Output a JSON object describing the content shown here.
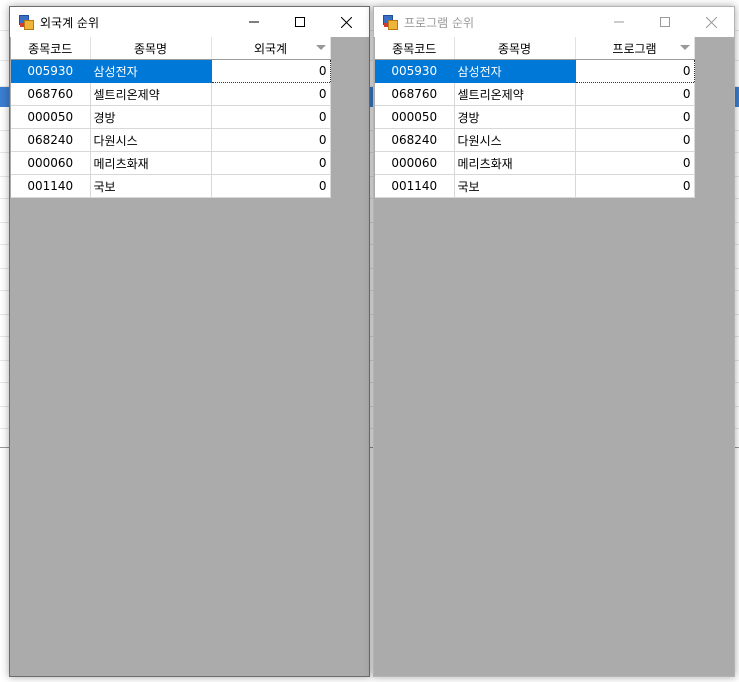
{
  "windows": [
    {
      "title": "외국계 순위",
      "active": true,
      "columns": [
        "종목코드",
        "종목명",
        "외국계"
      ],
      "rows": [
        {
          "code": "005930",
          "name": "삼성전자",
          "value": "0"
        },
        {
          "code": "068760",
          "name": "셀트리온제약",
          "value": "0"
        },
        {
          "code": "000050",
          "name": "경방",
          "value": "0"
        },
        {
          "code": "068240",
          "name": "다원시스",
          "value": "0"
        },
        {
          "code": "000060",
          "name": "메리츠화재",
          "value": "0"
        },
        {
          "code": "001140",
          "name": "국보",
          "value": "0"
        }
      ]
    },
    {
      "title": "프로그램 순위",
      "active": false,
      "columns": [
        "종목코드",
        "종목명",
        "프로그램"
      ],
      "rows": [
        {
          "code": "005930",
          "name": "삼성전자",
          "value": "0"
        },
        {
          "code": "068760",
          "name": "셀트리온제약",
          "value": "0"
        },
        {
          "code": "000050",
          "name": "경방",
          "value": "0"
        },
        {
          "code": "068240",
          "name": "다원시스",
          "value": "0"
        },
        {
          "code": "000060",
          "name": "메리츠화재",
          "value": "0"
        },
        {
          "code": "001140",
          "name": "국보",
          "value": "0"
        }
      ]
    }
  ],
  "selected_row_index": 0,
  "colors": {
    "selection": "#0078d7",
    "client_background": "#ababab"
  },
  "icons": [
    "app-icon",
    "minimize-icon",
    "maximize-icon",
    "close-icon",
    "sort-dropdown-icon"
  ]
}
